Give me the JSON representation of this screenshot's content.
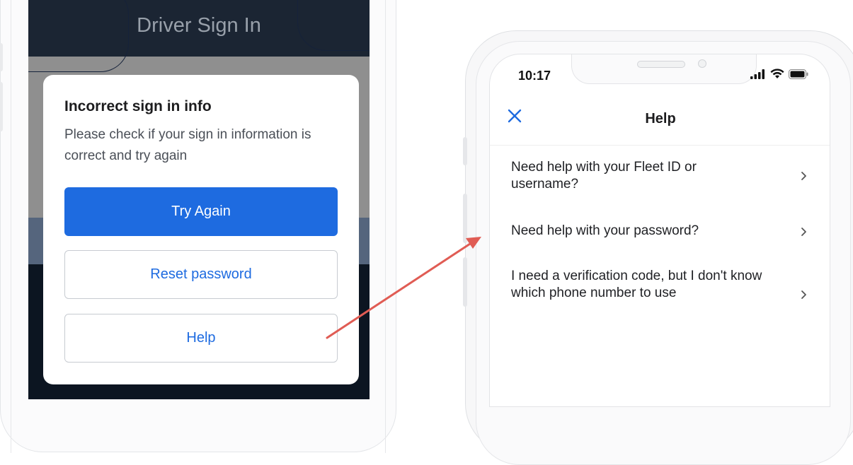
{
  "left_phone": {
    "header_title": "Driver Sign In",
    "dialog": {
      "title": "Incorrect sign in info",
      "message": "Please check if your sign in information is correct and try again",
      "try_again_label": "Try Again",
      "reset_password_label": "Reset password",
      "help_label": "Help"
    }
  },
  "right_phone": {
    "status": {
      "time": "10:17"
    },
    "nav": {
      "title": "Help",
      "close_icon": "close-icon"
    },
    "items": [
      {
        "label": "Need help with your Fleet ID or username?"
      },
      {
        "label": "Need help with your password?"
      },
      {
        "label": "I need a verification code, but I don't know which phone number to use"
      }
    ]
  },
  "colors": {
    "primary": "#1e6be0",
    "arrow": "#e05c54",
    "dark_bg": "#0e1722"
  }
}
